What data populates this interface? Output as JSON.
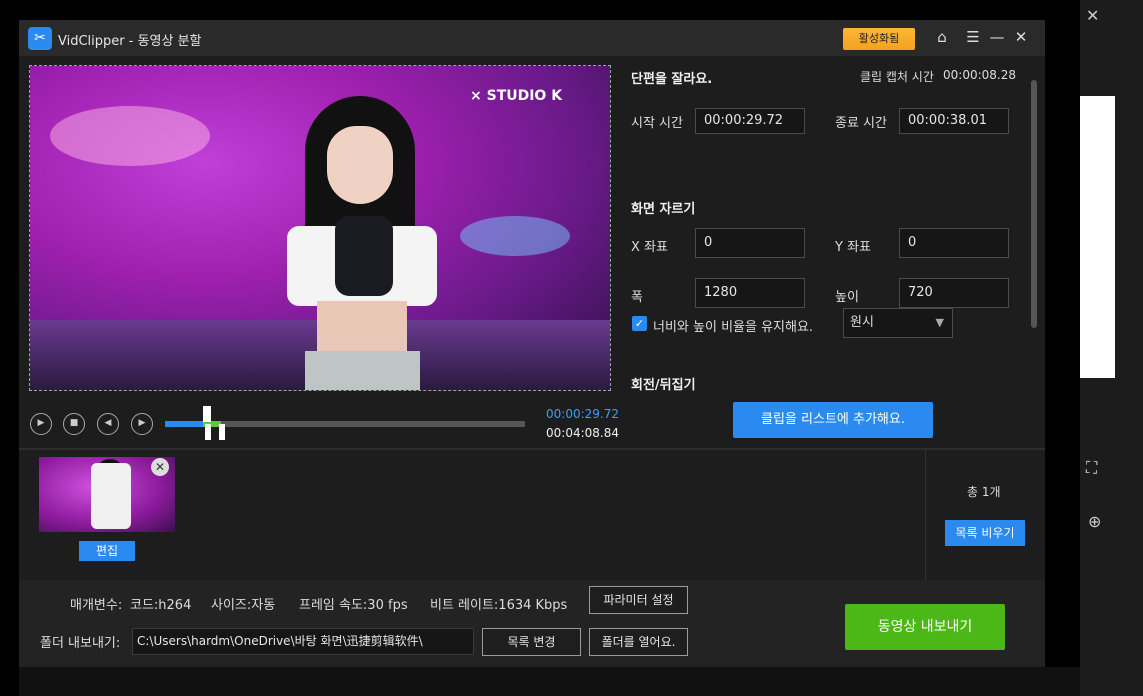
{
  "window": {
    "title": "VidClipper - 동영상 분할",
    "activate_label": "활성화됨"
  },
  "player": {
    "current_time": "00:00:29.72",
    "total_time": "00:04:08.84",
    "overlay_logo": "×  STUDIO K"
  },
  "clip": {
    "heading": "단편을 잘라요.",
    "capture_label": "클립 캡처 시간",
    "capture_value": "00:00:08.28",
    "start_label": "시작 시간",
    "start_value": "00:00:29.72",
    "end_label": "종료 시간",
    "end_value": "00:00:38.01"
  },
  "crop": {
    "heading": "화면 자르기",
    "x_label": "X 좌표",
    "x_value": "0",
    "y_label": "Y 좌표",
    "y_value": "0",
    "width_label": "폭",
    "width_value": "1280",
    "height_label": "높이",
    "height_value": "720",
    "keep_ratio_label": "너비와 높이 비율을 유지해요.",
    "keep_ratio_checked": true,
    "ratio_option": "원시"
  },
  "rotate": {
    "heading": "회전/뒤집기"
  },
  "add_to_list_label": "클립을 리스트에 추가해요.",
  "list": {
    "edit_label": "편집",
    "count_label": "총 1개",
    "clear_label": "목록 비우기"
  },
  "params": {
    "label": "매개변수:",
    "codec": "코드:h264",
    "size": "사이즈:자동",
    "fps": "프레임 속도:30 fps",
    "bitrate": "비트 레이트:1634 Kbps",
    "settings_label": "파라미터 설정"
  },
  "output": {
    "folder_label": "폴더 내보내기:",
    "path": "C:\\Users\\hardm\\OneDrive\\바탕 화면\\迅捷剪辑软件\\",
    "change_label": "목록 변경",
    "open_label": "폴더를 열어요.",
    "export_label": "동영상 내보내기"
  },
  "colors": {
    "accent": "#2a8af0",
    "export": "#4cb818",
    "activate": "#f5a21d"
  }
}
